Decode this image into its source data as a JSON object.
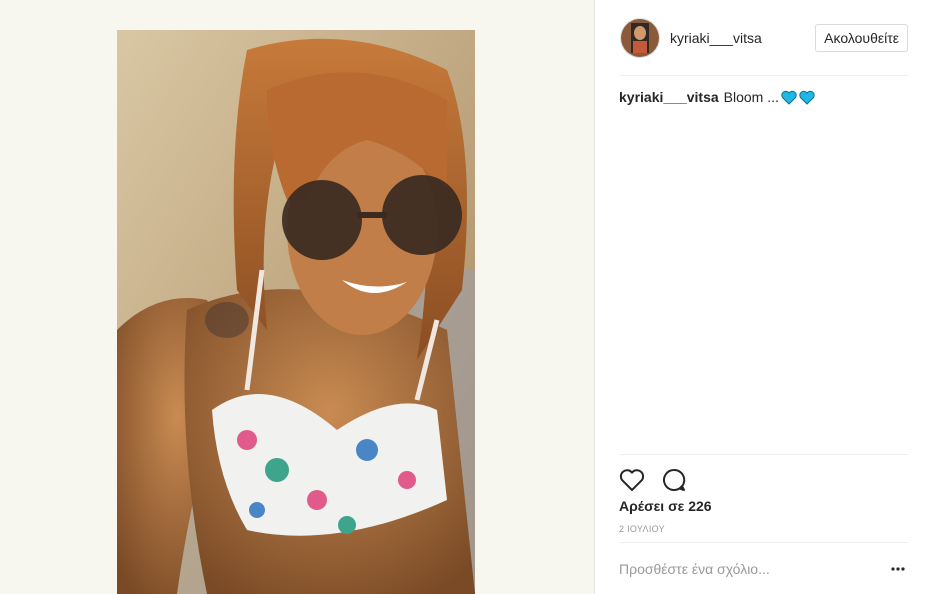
{
  "post": {
    "username": "kyriaki___vitsa",
    "follow_label": "Ακολουθείτε",
    "caption_user": "kyriaki___vitsa",
    "caption_text": "Bloom ...",
    "caption_emoji_icon": "blue-heart-icon",
    "likes_text": "Αρέσει σε 226",
    "date_text": "2 ΙΟΥΛΙΟΥ",
    "comment_placeholder": "Προσθέστε ένα σχόλιο...",
    "icons": {
      "like": "heart-outline-icon",
      "comment": "comment-bubble-icon",
      "more": "more-dots-icon"
    }
  },
  "colors": {
    "text": "#262626",
    "muted": "#999999",
    "border": "#efefef",
    "media_background": "#f8f7ef",
    "emoji_blue": "#1fb8e6"
  }
}
